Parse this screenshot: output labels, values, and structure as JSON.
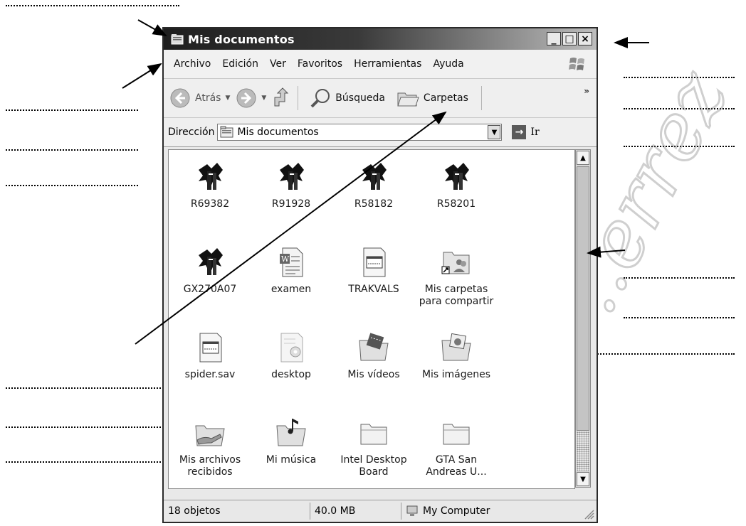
{
  "window": {
    "title": "Mis documentos",
    "controls": {
      "minimize": "_",
      "maximize": "□",
      "close": "×"
    }
  },
  "menu": [
    "Archivo",
    "Edición",
    "Ver",
    "Favoritos",
    "Herramientas",
    "Ayuda"
  ],
  "toolbar": {
    "back_label": "Atrás",
    "search_label": "Búsqueda",
    "folders_label": "Carpetas",
    "more": "»"
  },
  "address": {
    "label": "Dirección",
    "value": "Mis documentos",
    "go_label": "Ir"
  },
  "files": [
    {
      "name": "R69382",
      "icon": "program-icon"
    },
    {
      "name": "R91928",
      "icon": "program-icon"
    },
    {
      "name": "R58182",
      "icon": "program-icon"
    },
    {
      "name": "R58201",
      "icon": "program-icon"
    },
    {
      "name": "GX270A07",
      "icon": "program-icon"
    },
    {
      "name": "examen",
      "icon": "word-document-icon"
    },
    {
      "name": "TRAKVALS",
      "icon": "data-file-icon"
    },
    {
      "name": "Mis carpetas para compartir",
      "icon": "shared-folder-icon"
    },
    {
      "name": "spider.sav",
      "icon": "data-file-icon"
    },
    {
      "name": "desktop",
      "icon": "settings-file-icon"
    },
    {
      "name": "Mis vídeos",
      "icon": "videos-folder-icon"
    },
    {
      "name": "Mis imágenes",
      "icon": "pictures-folder-icon"
    },
    {
      "name": "Mis archivos recibidos",
      "icon": "received-folder-icon"
    },
    {
      "name": "Mi música",
      "icon": "music-folder-icon"
    },
    {
      "name": "Intel Desktop Board",
      "icon": "folder-icon"
    },
    {
      "name": "GTA San Andreas U...",
      "icon": "folder-icon"
    }
  ],
  "status": {
    "count": "18 objetos",
    "size": "40.0 MB",
    "location": "My Computer"
  },
  "watermark": "..errez"
}
